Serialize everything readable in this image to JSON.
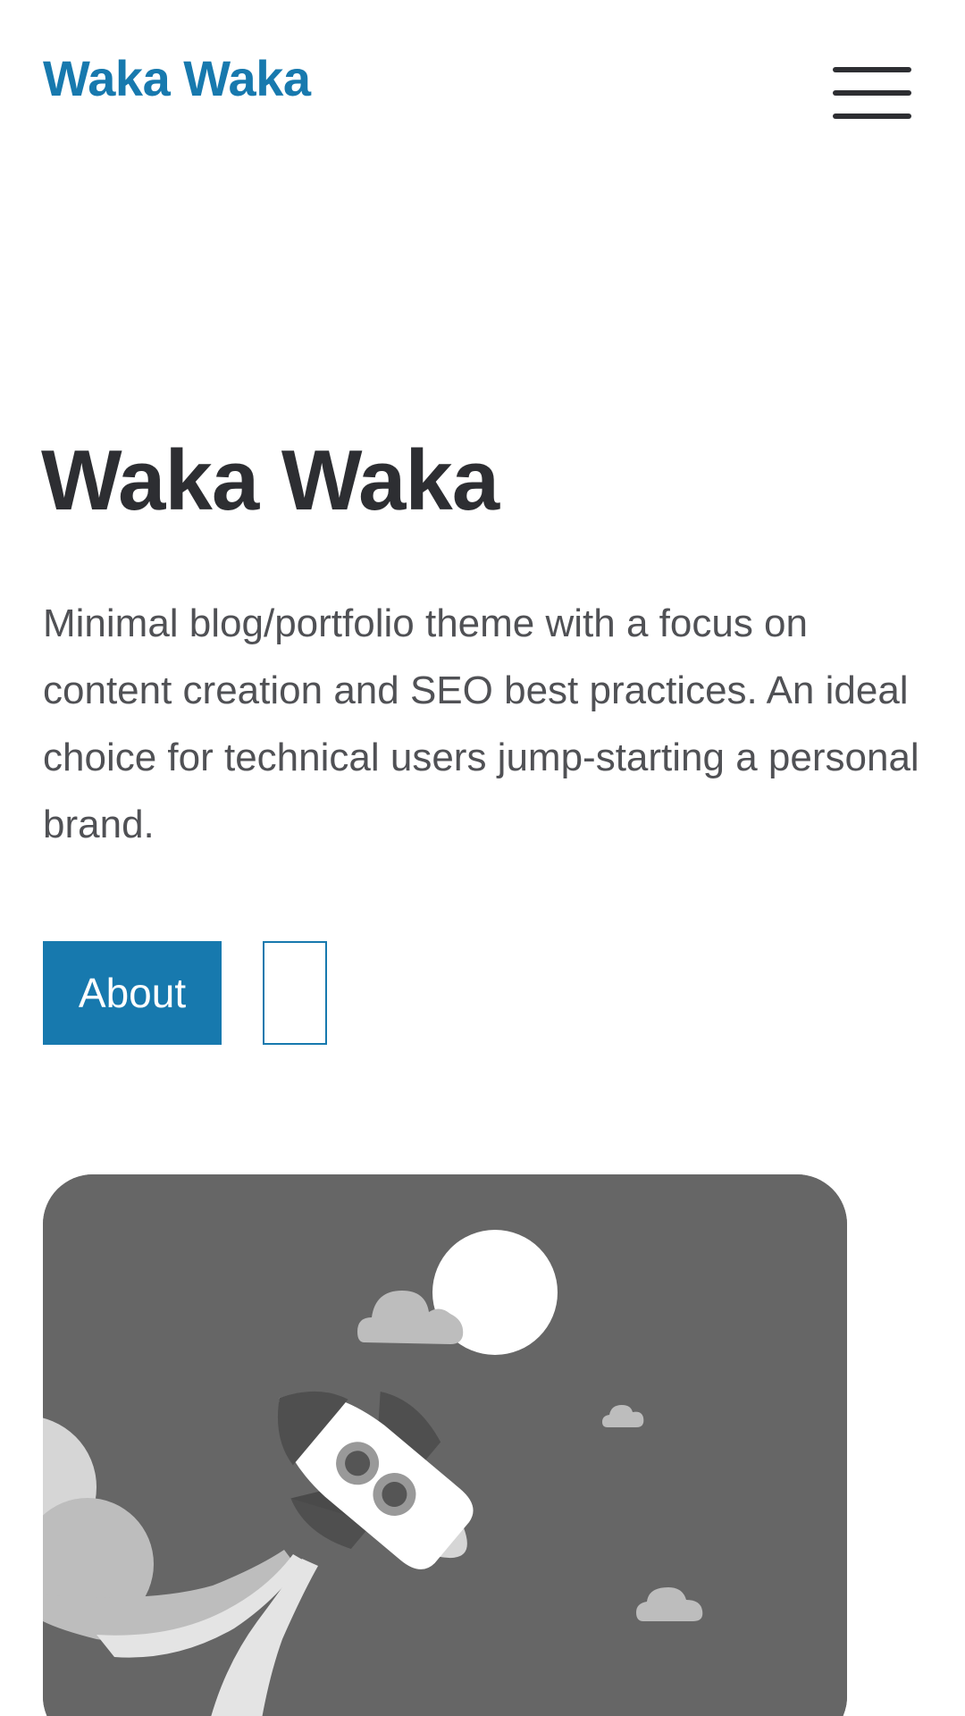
{
  "header": {
    "brand": "Waka Waka",
    "menu_icon": "hamburger-menu-icon"
  },
  "hero": {
    "title": "Waka Waka",
    "description": "Minimal blog/portfolio theme with a focus on content creation and SEO best practices. An ideal choice for technical users jump-starting a personal brand.",
    "primary_button_label": "About",
    "secondary_button_label": ""
  },
  "illustration": {
    "subject": "rocket-launch-illustration",
    "elements": [
      "moon-icon",
      "cloud-icon",
      "rocket-icon",
      "smoke-cloud-icon"
    ]
  },
  "colors": {
    "accent": "#1779ae",
    "heading": "#2d2e32",
    "body_text": "#505155",
    "illustration_bg": "#666666"
  }
}
